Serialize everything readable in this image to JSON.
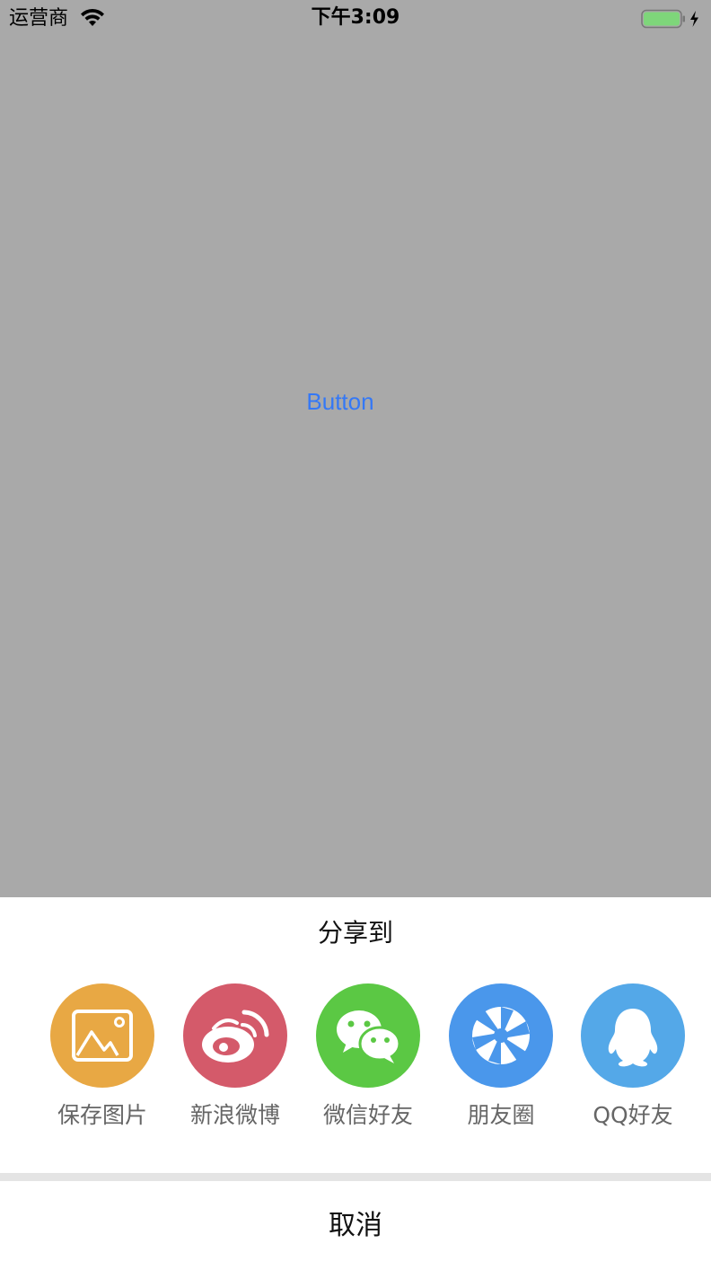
{
  "status_bar": {
    "carrier": "运营商",
    "time": "下午3:09",
    "battery_color": "#7ed67a",
    "icons": [
      "wifi-icon",
      "battery-icon",
      "charging-bolt-icon"
    ]
  },
  "main": {
    "button_label": "Button",
    "background_color": "#a9a9a9",
    "button_color": "#3478f6"
  },
  "share_sheet": {
    "title": "分享到",
    "items": [
      {
        "label": "保存图片",
        "icon": "picture-icon",
        "color": "#e8a844"
      },
      {
        "label": "新浪微博",
        "icon": "weibo-icon",
        "color": "#d45a6a"
      },
      {
        "label": "微信好友",
        "icon": "wechat-icon",
        "color": "#5bc844"
      },
      {
        "label": "朋友圈",
        "icon": "moments-shutter-icon",
        "color": "#4a97eb"
      },
      {
        "label": "QQ好友",
        "icon": "qq-penguin-icon",
        "color": "#54a8e8"
      }
    ],
    "cancel_label": "取消"
  }
}
